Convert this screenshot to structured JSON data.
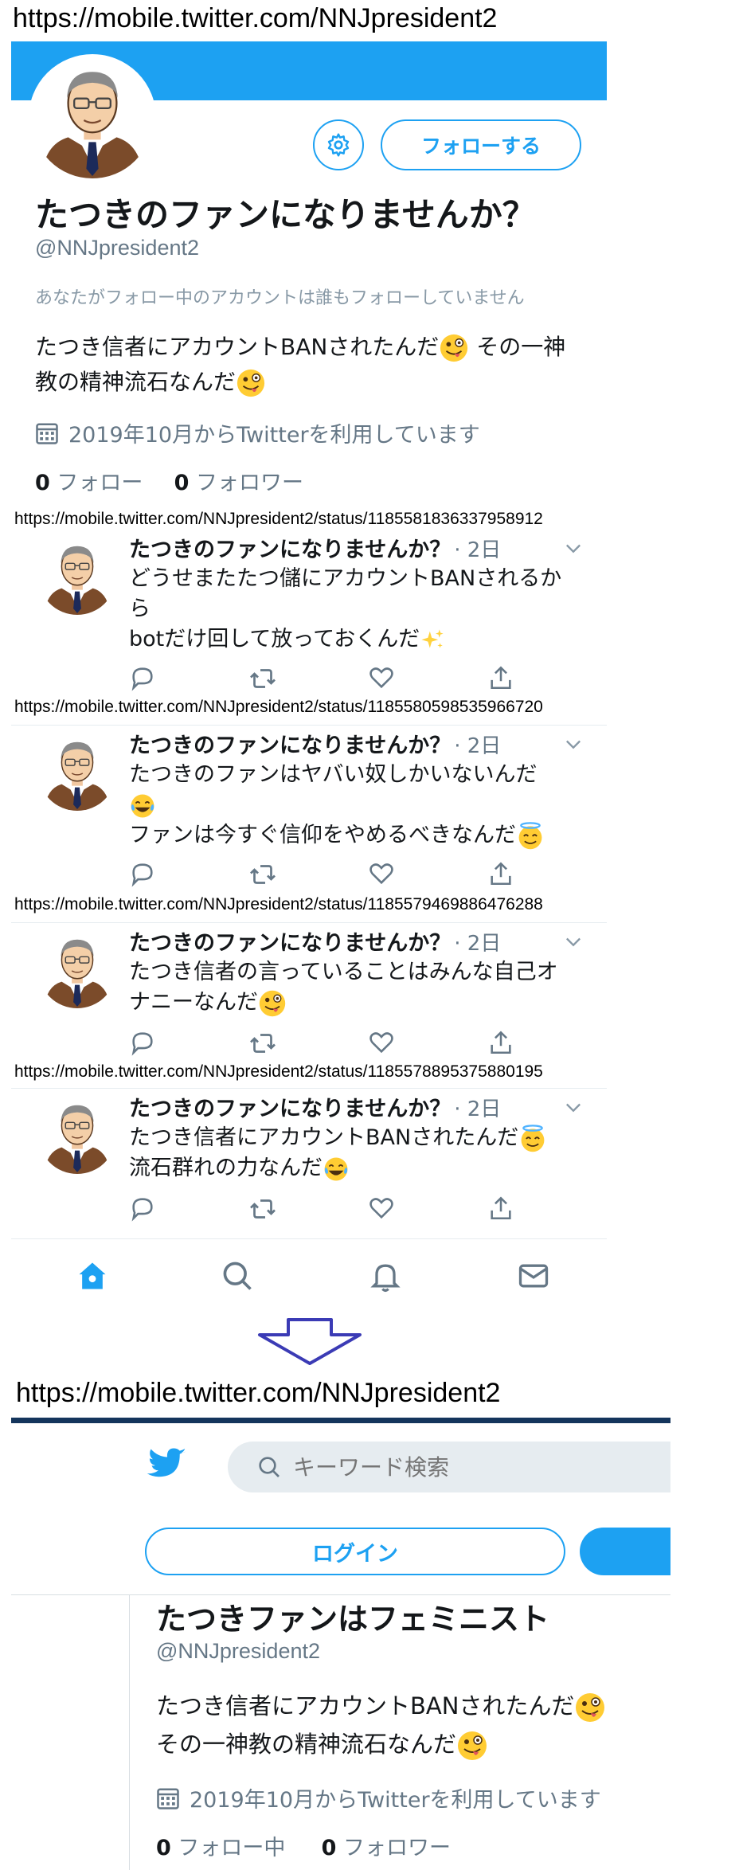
{
  "profile_url": "https://mobile.twitter.com/NNJpresident2",
  "top": {
    "follow_label": "フォローする",
    "display_name": "たつきのファンになりませんか？",
    "handle": "@NNJpresident2",
    "mutual_note": "あなたがフォロー中のアカウントは誰もフォローしていません",
    "bio_line1": "たつき信者にアカウントBANされたんだ",
    "bio_line1_tail": " その一神",
    "bio_line2": "教の精神流石なんだ",
    "joined": "2019年10月からTwitterを利用しています",
    "following_count": "0",
    "following_label": " フォロー",
    "followers_count": "0",
    "followers_label": " フォロワー"
  },
  "tweets": [
    {
      "url": "https://mobile.twitter.com/NNJpresident2/status/1185581836337958912",
      "name": "たつきのファンになりませんか？",
      "time": "· 2日",
      "line1": "どうせまたたつ儲にアカウントBANされるか",
      "line2": "ら",
      "line3": "botだけ回して放っておくんだ",
      "emoji1": "sparkles",
      "emoji2": ""
    },
    {
      "url": "https://mobile.twitter.com/NNJpresident2/status/1185580598535966720",
      "name": "たつきのファンになりませんか？",
      "time": "· 2日",
      "line1": "たつきのファンはヤバい奴しかいないんだ",
      "line2": "",
      "line3": "ファンは今すぐ信仰をやめるべきなんだ",
      "emoji1": "tears-of-joy",
      "emoji2": "halo"
    },
    {
      "url": "https://mobile.twitter.com/NNJpresident2/status/1185579469886476288",
      "name": "たつきのファンになりませんか？",
      "time": "· 2日",
      "line1": "たつき信者の言っていることはみんな自己オ",
      "line2": "ナニーなんだ",
      "line3": "",
      "emoji1": "zany",
      "emoji2": ""
    },
    {
      "url": "https://mobile.twitter.com/NNJpresident2/status/1185578895375880195",
      "name": "たつきのファンになりませんか？",
      "time": "· 2日",
      "line1": "たつき信者にアカウントBANされたんだ",
      "line2": "流石群れの力なんだ",
      "line3": "",
      "emoji1": "halo",
      "emoji2": "tears-of-joy"
    }
  ],
  "bottom_nav": [
    "home-icon",
    "search-icon",
    "bell-icon",
    "mail-icon"
  ],
  "second": {
    "url": "https://mobile.twitter.com/NNJpresident2",
    "search_placeholder": "キーワード検索",
    "login_label": "ログイン",
    "display_name": "たつきファンはフェミニスト",
    "handle": "@NNJpresident2",
    "bio_line1": "たつき信者にアカウントBANされたんだ",
    "bio_line2": "その一神教の精神流石なんだ",
    "joined": "2019年10月からTwitterを利用しています",
    "following_count": "0",
    "following_label": " フォロー中",
    "followers_count": "0",
    "followers_label": " フォロワー"
  },
  "colors": {
    "accent": "#1da1f2",
    "muted": "#657786",
    "dark_bar": "#14355c",
    "arrow": "#3b3bb5"
  }
}
